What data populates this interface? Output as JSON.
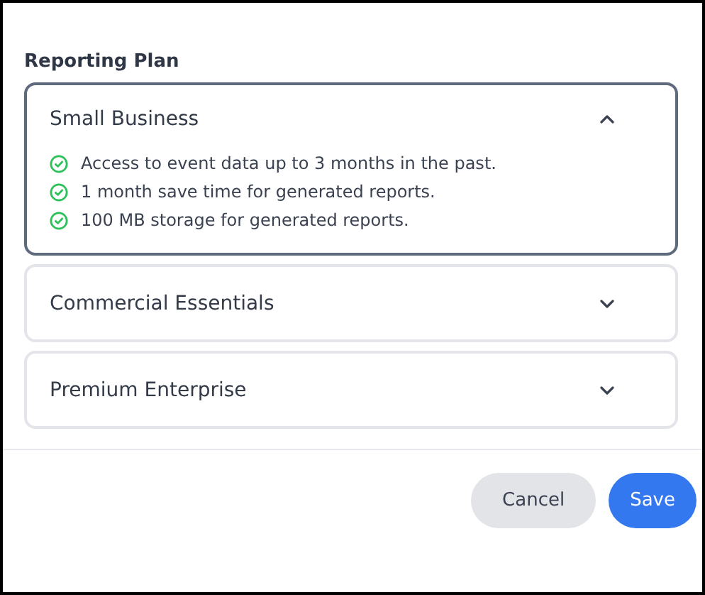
{
  "section_label": "Reporting Plan",
  "plans": [
    {
      "name": "Small Business",
      "expanded": true,
      "features": [
        "Access to event data up to 3 months in the past.",
        "1 month save time for generated reports.",
        "100 MB storage for generated reports."
      ]
    },
    {
      "name": "Commercial Essentials",
      "expanded": false
    },
    {
      "name": "Premium Enterprise",
      "expanded": false
    }
  ],
  "buttons": [
    {
      "label": "Cancel",
      "kind": "secondary"
    },
    {
      "label": "Save",
      "kind": "primary"
    }
  ]
}
